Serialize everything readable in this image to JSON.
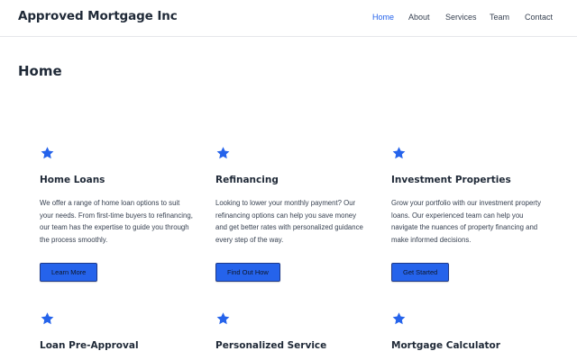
{
  "header": {
    "brand": "Approved Mortgage Inc",
    "nav": [
      {
        "label": "Home",
        "active": true
      },
      {
        "label": "About",
        "active": false
      },
      {
        "label": "Services",
        "active": false
      },
      {
        "label": "Team",
        "active": false
      },
      {
        "label": "Contact",
        "active": false
      }
    ]
  },
  "page": {
    "title": "Home"
  },
  "cards": [
    {
      "icon": "star-icon",
      "title": "Home Loans",
      "description": "We offer a range of home loan options to suit your needs. From first-time buyers to refinancing, our team has the expertise to guide you through the process smoothly.",
      "button": "Learn More"
    },
    {
      "icon": "star-icon",
      "title": "Refinancing",
      "description": "Looking to lower your monthly payment? Our refinancing options can help you save money and get better rates with personalized guidance every step of the way.",
      "button": "Find Out How"
    },
    {
      "icon": "star-icon",
      "title": "Investment Properties",
      "description": "Grow your portfolio with our investment property loans. Our experienced team can help you navigate the nuances of property financing and make informed decisions.",
      "button": "Get Started"
    },
    {
      "icon": "star-icon",
      "title": "Loan Pre-Approval"
    },
    {
      "icon": "star-icon",
      "title": "Personalized Service"
    },
    {
      "icon": "star-icon",
      "title": "Mortgage Calculator"
    }
  ],
  "colors": {
    "accent": "#2563eb",
    "button_border": "#1e3a8a",
    "text": "#1f2937",
    "divider": "#e5e7eb"
  }
}
